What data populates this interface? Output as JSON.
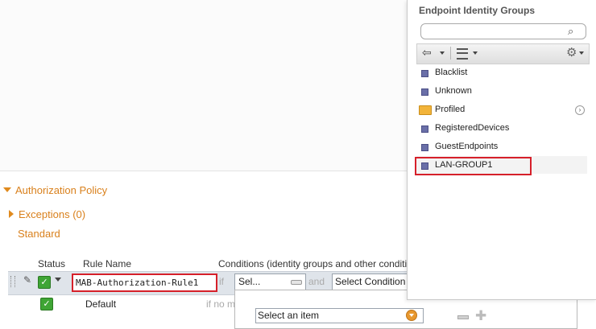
{
  "panel": {
    "title": "Endpoint Identity Groups",
    "items": [
      {
        "label": "Blacklist",
        "icon": "group-bullet-icon"
      },
      {
        "label": "Unknown",
        "icon": "group-bullet-icon"
      },
      {
        "label": "Profiled",
        "icon": "folder-icon"
      },
      {
        "label": "RegisteredDevices",
        "icon": "group-bullet-icon"
      },
      {
        "label": "GuestEndpoints",
        "icon": "group-bullet-icon"
      },
      {
        "label": "LAN-GROUP1",
        "icon": "group-bullet-icon"
      }
    ]
  },
  "section": {
    "title": "Authorization Policy",
    "exceptions": "Exceptions (0)",
    "standard": "Standard"
  },
  "table": {
    "col_status": "Status",
    "col_rule_name": "Rule Name",
    "col_conditions": "Conditions (identity groups and other conditi"
  },
  "rule": {
    "name": "MAB-Authorization-Rule1",
    "if": "if",
    "and": "and",
    "sel": "Sel...",
    "select_condition": "Select Condition"
  },
  "default_row": {
    "name": "Default",
    "if_no": "if no m"
  },
  "popup": {
    "select_item": "Select an item"
  },
  "colors": {
    "accent_orange": "#d9801c",
    "highlight_red": "#d6202a",
    "check_green": "#3fa535"
  }
}
